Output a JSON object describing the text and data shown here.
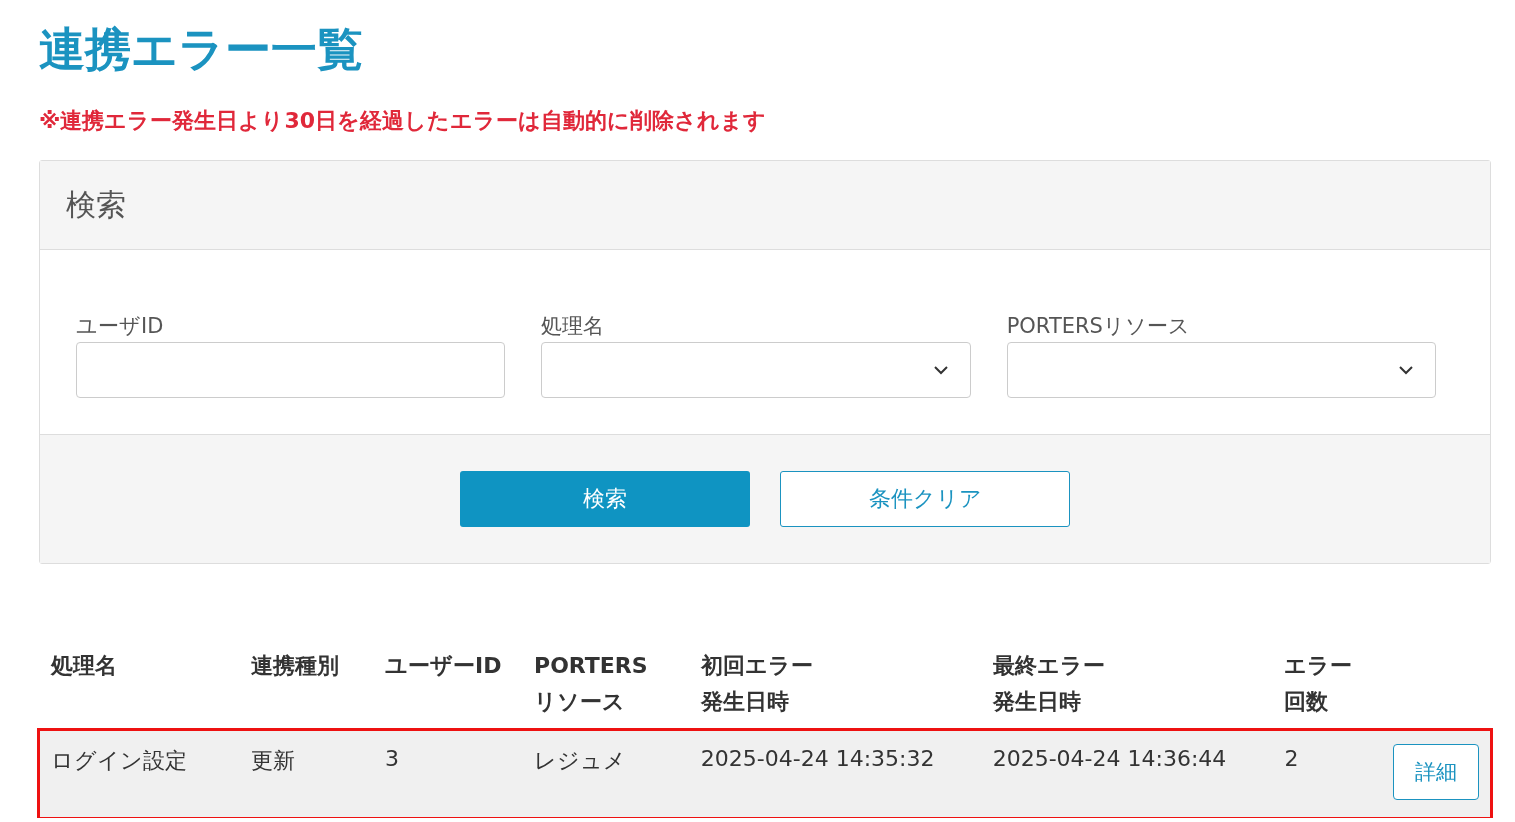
{
  "title": "連携エラー一覧",
  "notice": "※連携エラー発生日より30日を経過したエラーは自動的に削除されます",
  "search_panel": {
    "title": "検索",
    "fields": [
      {
        "kind": "text",
        "label": "ユーザID"
      },
      {
        "kind": "select",
        "label": "処理名"
      },
      {
        "kind": "select",
        "label": "PORTERSリソース"
      }
    ],
    "buttons": [
      {
        "kind": "primary",
        "label": "検索"
      },
      {
        "kind": "secondary",
        "label": "条件クリア"
      }
    ]
  },
  "table": {
    "columns": [
      {
        "lines": [
          "処理名"
        ]
      },
      {
        "lines": [
          "連携種別"
        ]
      },
      {
        "lines": [
          "ユーザーID"
        ]
      },
      {
        "lines": [
          "PORTERS",
          "リソース"
        ]
      },
      {
        "lines": [
          "初回エラー",
          "発生日時"
        ]
      },
      {
        "lines": [
          "最終エラー",
          "発生日時"
        ]
      },
      {
        "lines": [
          "エラー",
          "回数"
        ]
      }
    ],
    "rows": [
      {
        "highlighted": true,
        "cells": [
          "ログイン設定",
          "更新",
          "3",
          "レジュメ",
          "2025-04-24 14:35:32",
          "2025-04-24 14:36:44",
          "2"
        ],
        "button": "詳細"
      }
    ]
  }
}
